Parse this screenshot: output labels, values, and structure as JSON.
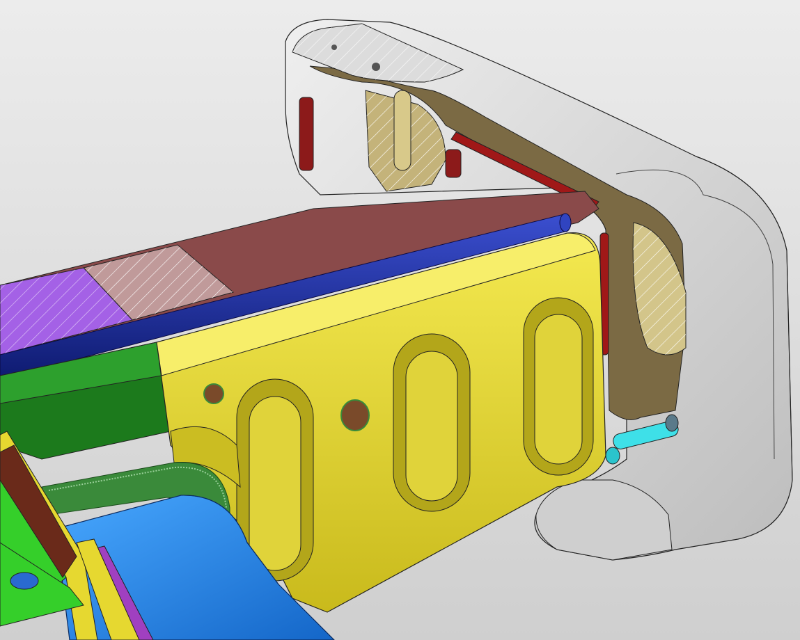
{
  "viewport": {
    "background_top": "#ececec",
    "background_bottom": "#cfcfcf"
  },
  "scene": {
    "kind": "cad-section-view",
    "icon": "3d-model-icon",
    "colors": {
      "end_cap": "#d6d6d6",
      "end_cap_face": "#8a8a8a",
      "end_cap_inner": "#6e5a3a",
      "bracket_yellow": "#d9c92a",
      "bracket_yellow_light": "#f2e64a",
      "bracket_yellow_dark": "#9c8f16",
      "rod_blue": "#1f2fa0",
      "top_plate_brown": "#8a4a4a",
      "section_purple": "#a461e6",
      "green_part": "#1c7a1c",
      "green_bright": "#35cf2a",
      "cyan_pin": "#3ee0e8",
      "blue_housing": "#1e8ef0",
      "magenta_strip": "#a040c0",
      "red_slot": "#a01818",
      "hatch": "#ffffff"
    }
  }
}
